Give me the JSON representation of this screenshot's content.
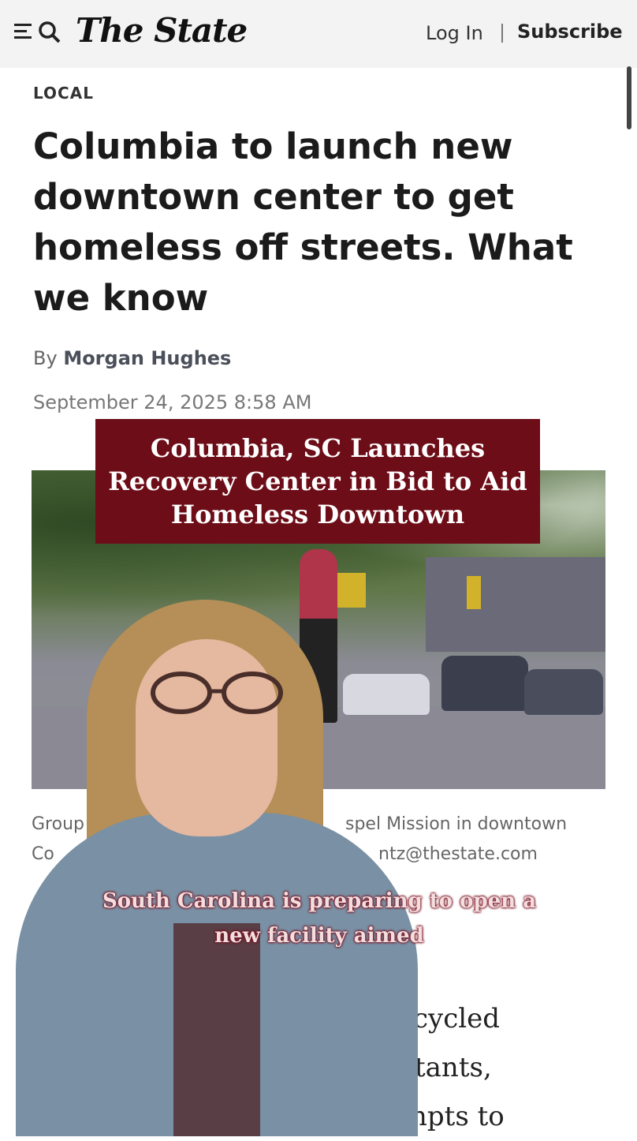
{
  "header": {
    "logo_text": "The State",
    "login_label": "Log In",
    "subscribe_label": "Subscribe",
    "menu_icon": "menu-icon",
    "search_icon": "search-icon"
  },
  "article": {
    "section": "LOCAL",
    "headline": "Columbia to launch new downtown center to get homeless off streets. What we know",
    "byline_prefix": "By",
    "author": "Morgan Hughes",
    "date": "September 24, 2025 8:58 AM",
    "caption_line1": "Group",
    "caption_line1_end": "spel Mission in downtown",
    "caption_line2": "Co",
    "caption_line2_end": "ntz@thestate.com",
    "body_fragments": [
      "cycled",
      "tants,",
      "npts to"
    ]
  },
  "overlay": {
    "title": "Columbia, SC Launches Recovery Center in Bid to Aid Homeless Downtown",
    "subtitle": "South Carolina is preparing to open a new facility aimed"
  },
  "colors": {
    "overlay_bg": "#6d0d17",
    "header_bg": "#f3f3f4"
  }
}
